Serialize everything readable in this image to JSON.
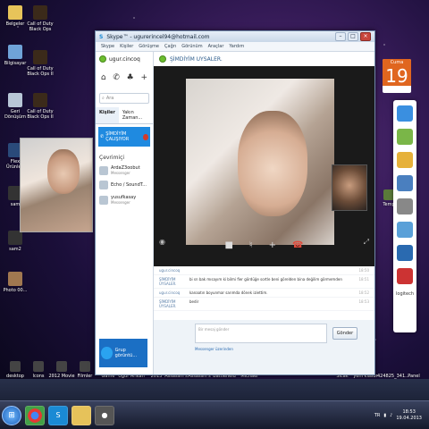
{
  "desktop": {
    "left_icons": [
      "Belgeler",
      "Bilgisayar",
      "Geri Dönüşüm",
      "Flex Ürünleri",
      "sam",
      "sam2",
      "Photo 00..."
    ],
    "mid_icons": [
      "Call of Duty Black Ops",
      "Call of Duty Black Ops II",
      "Call of Duty Black Ops II"
    ],
    "bottom_icons": [
      "desktop",
      "Icons",
      "2012 Movie",
      "Filmler",
      "Game Maker Pro",
      "Ugur Arikan Flash Calis...",
      "2013",
      "Assassin's Creed Underworld",
      "Assassin's Where D...",
      "Battlefield 3 Epic Sea Guy",
      "Michael Phelps Proje...",
      "Sicak",
      "yeni klasör",
      "424825_341...",
      "Panel Aulearn"
    ],
    "right_icons": [
      "Temp"
    ]
  },
  "skype": {
    "window_title": "Skype™ - ugurerincel94@hotmail.com",
    "menu": [
      "Skype",
      "Kişiler",
      "Görüşme",
      "Çağrı",
      "Görünüm",
      "Araçlar",
      "Yardım"
    ],
    "user": "ugur.cincoq",
    "search_placeholder": "Ara",
    "tabs": [
      "Kişiler",
      "Yakın Zaman..."
    ],
    "active_call": "ŞİMDİYİM ÇALIŞIYOR",
    "online_section": "Çevrimiçi",
    "contacts": [
      {
        "name": "ArdaZ3oobut",
        "status": "Messenger"
      },
      {
        "name": "Echo / SoundT...",
        "status": ""
      },
      {
        "name": "yusufkasay",
        "status": "Messenger"
      }
    ],
    "group_ad": "Grup görüntü...",
    "call_header": "ŞİMDİYİM UYSALER.",
    "messages": [
      {
        "who": "ugur.cincoq",
        "text": "",
        "time": "18:50"
      },
      {
        "who": "ŞİMDİYİM UYSALER.",
        "text": "bi sn bak mısayım ki bilmi fier gördüğe sortle beni görelden bina değilim görmemden",
        "time": "18:51"
      },
      {
        "who": "ugur.cincoq",
        "text": "kanaatın boyunmar sarımda dönek iziettim.",
        "time": "18:52"
      },
      {
        "who": "ŞİMDİYİM UYSALER.",
        "text": "bedir",
        "time": "18:53"
      }
    ],
    "compose_placeholder": "Bir mesaj gönder",
    "send_button": "Gönder",
    "send_via": "Messenger üzerinden"
  },
  "calendar": {
    "day": "Cuma",
    "date": "19"
  },
  "gadget_brand": "logitech",
  "taskbar": {
    "time": "18:53",
    "date": "19.04.2013",
    "lang": "TR"
  }
}
